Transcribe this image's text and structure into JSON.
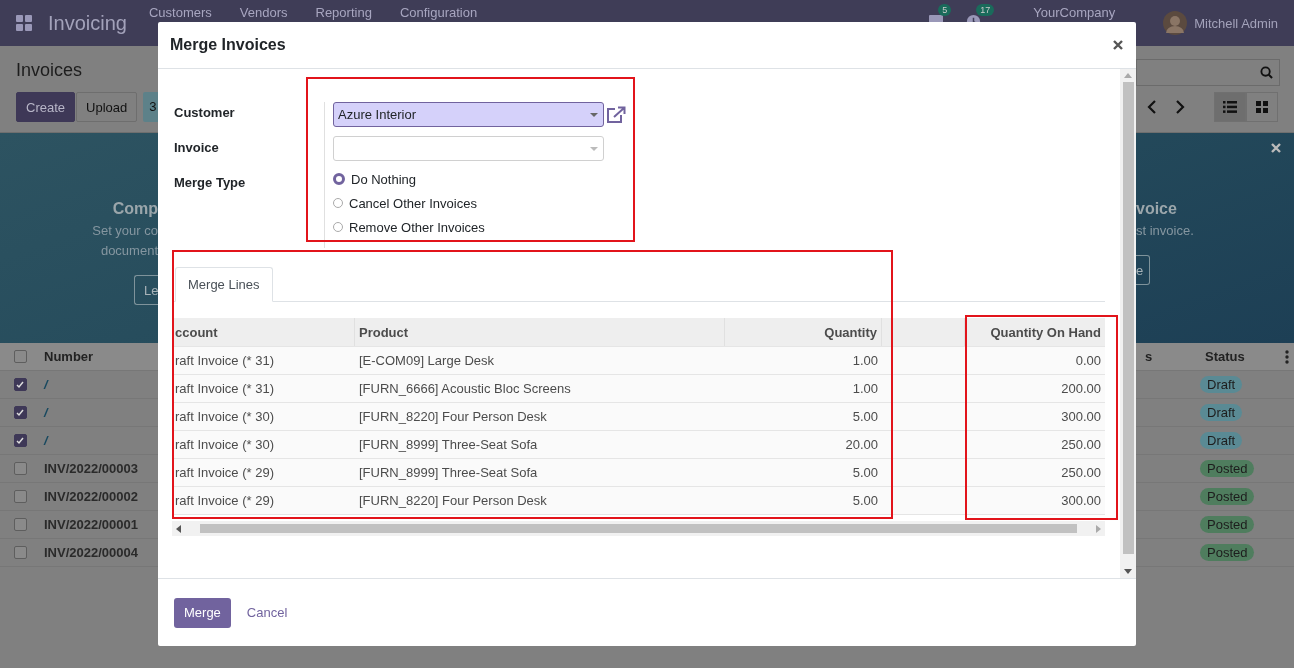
{
  "app_bar": {
    "app_name": "Invoicing",
    "menu": [
      "Customers",
      "Vendors",
      "Reporting",
      "Configuration"
    ],
    "messages_count": "5",
    "activities_count": "17",
    "company": "YourCompany",
    "user": "Mitchell Admin"
  },
  "control_panel": {
    "title": "Invoices",
    "buttons": [
      "Create",
      "Upload"
    ],
    "selected_count": "3"
  },
  "banner": {
    "left_heading": "Comp",
    "left_lines": [
      "Set your co",
      "document"
    ],
    "left_button": "Le",
    "right_heading": "voice",
    "right_line": "st invoice.",
    "right_button": "e"
  },
  "list": {
    "all_checked": false,
    "columns": [
      "Number",
      "s",
      "Status"
    ],
    "rows": [
      {
        "checked": true,
        "number": "/",
        "status": "Draft",
        "kind": "draft"
      },
      {
        "checked": true,
        "number": "/",
        "status": "Draft",
        "kind": "draft"
      },
      {
        "checked": true,
        "number": "/",
        "status": "Draft",
        "kind": "draft"
      },
      {
        "checked": false,
        "number": "INV/2022/00003",
        "status": "Posted",
        "kind": "posted"
      },
      {
        "checked": false,
        "number": "INV/2022/00002",
        "status": "Posted",
        "kind": "posted"
      },
      {
        "checked": false,
        "number": "INV/2022/00001",
        "status": "Posted",
        "kind": "posted"
      },
      {
        "checked": false,
        "number": "INV/2022/00004",
        "status": "Posted",
        "kind": "posted"
      }
    ]
  },
  "dialog": {
    "title": "Merge Invoices",
    "customer": {
      "label": "Customer",
      "value": "Azure Interior"
    },
    "invoice": {
      "label": "Invoice"
    },
    "merge_type": {
      "label": "Merge Type",
      "options": [
        {
          "label": "Do Nothing",
          "selected": true
        },
        {
          "label": "Cancel Other Invoices",
          "selected": false
        },
        {
          "label": "Remove Other Invoices",
          "selected": false
        }
      ]
    },
    "tab": "Merge Lines",
    "table": {
      "header": {
        "account": "ccount",
        "product": "Product",
        "quantity": "Quantity",
        "quantity_on_hand": "Quantity On Hand"
      },
      "rows": [
        {
          "account": "raft Invoice (* 31)",
          "product": "[E-COM09] Large Desk",
          "quantity": "1.00",
          "quantity_on_hand": "0.00"
        },
        {
          "account": "raft Invoice (* 31)",
          "product": "[FURN_6666] Acoustic Bloc Screens",
          "quantity": "1.00",
          "quantity_on_hand": "200.00"
        },
        {
          "account": "raft Invoice (* 30)",
          "product": "[FURN_8220] Four Person Desk",
          "quantity": "5.00",
          "quantity_on_hand": "300.00"
        },
        {
          "account": "raft Invoice (* 30)",
          "product": "[FURN_8999] Three-Seat Sofa",
          "quantity": "20.00",
          "quantity_on_hand": "250.00"
        },
        {
          "account": "raft Invoice (* 29)",
          "product": "[FURN_8999] Three-Seat Sofa",
          "quantity": "5.00",
          "quantity_on_hand": "250.00"
        },
        {
          "account": "raft Invoice (* 29)",
          "product": "[FURN_8220] Four Person Desk",
          "quantity": "5.00",
          "quantity_on_hand": "300.00"
        }
      ]
    },
    "buttons": [
      {
        "label": "Merge",
        "kind": "primary"
      },
      {
        "label": "Cancel",
        "kind": "link"
      }
    ]
  }
}
